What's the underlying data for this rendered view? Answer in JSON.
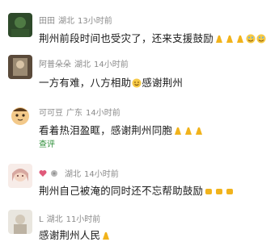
{
  "comments": [
    {
      "user": "田田",
      "location": "湖北",
      "time": "13小时前",
      "text": "荆州前段时间也受灾了，还来支援鼓励"
    },
    {
      "user": "阿普朵朵",
      "location": "湖北",
      "time": "14小时前",
      "text_a": "一方有难，八方相助",
      "text_b": "感谢荆州"
    },
    {
      "user": "可可豆",
      "location": "广东",
      "time": "14小时前",
      "text": "看着热泪盈眶，感谢荆州同胞",
      "translate": "查评"
    },
    {
      "user": "",
      "location": "湖北",
      "time": "14小时前",
      "text": "荆州自己被淹的同时还不忘帮助鼓励"
    },
    {
      "user": "L",
      "location": "湖北",
      "time": "11小时前",
      "text": "感谢荆州人民"
    }
  ],
  "icons": [
    "pray-emoji",
    "laughing-emoji",
    "smile-emoji",
    "heart-emoji"
  ],
  "colors": {
    "meta": "#8a8a8a",
    "accent": "#2f8f3a",
    "pray": "#f1b31c"
  }
}
